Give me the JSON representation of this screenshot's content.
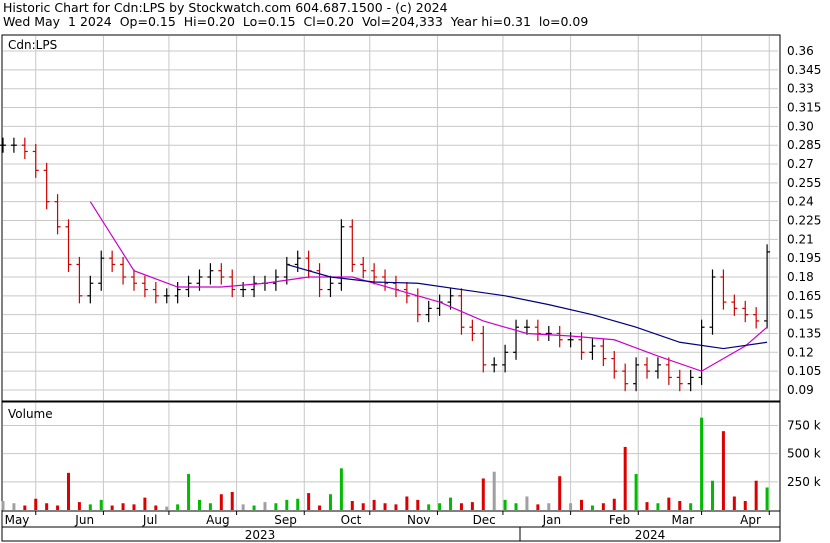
{
  "header": {
    "line1": "Historic Chart for Cdn:LPS by Stockwatch.com 604.687.1500 - (c) 2024",
    "line2": "Wed May  1 2024  Op=0.15  Hi=0.20  Lo=0.15  Cl=0.20  Vol=204,333  Year hi=0.31  lo=0.09"
  },
  "colors": {
    "up_bar": "#000000",
    "down_bar": "#cc0000",
    "ma_short": "#cc00cc",
    "ma_long": "#000080",
    "vol_up": "#00bb00",
    "vol_down": "#dd0000",
    "vol_flat": "#a0a0a0",
    "grid": "#c8c8c8"
  },
  "chart_data": [
    {
      "type": "ohlc",
      "title": "Cdn:LPS",
      "y_ticks": [
        "0.36",
        "0.345",
        "0.33",
        "0.315",
        "0.30",
        "0.285",
        "0.27",
        "0.255",
        "0.24",
        "0.225",
        "0.21",
        "0.195",
        "0.18",
        "0.165",
        "0.15",
        "0.135",
        "0.12",
        "0.105",
        "0.09"
      ],
      "ylim": [
        0.082,
        0.372
      ],
      "months": [
        "May",
        "Jun",
        "Jul",
        "Aug",
        "Sep",
        "Oct",
        "Nov",
        "Dec",
        "Jan",
        "Feb",
        "Mar",
        "Apr"
      ],
      "years": [
        "2023",
        "2024"
      ],
      "grid": true,
      "series": [
        {
          "style": "ohlc",
          "x": [
            0,
            5,
            10,
            15,
            20,
            25,
            30,
            35,
            40,
            45,
            50,
            55,
            60,
            65,
            70,
            75,
            80,
            85,
            90,
            95,
            100,
            105,
            110,
            115,
            120,
            125,
            130,
            135,
            140,
            145,
            150,
            155,
            160,
            165,
            170,
            175,
            180,
            185,
            190,
            195,
            200,
            205,
            210,
            215,
            220,
            225,
            230,
            235,
            240,
            245,
            250,
            255,
            260,
            265,
            270,
            275,
            280,
            285,
            290,
            295,
            300,
            305,
            310,
            315,
            320,
            325,
            330,
            335,
            340,
            345,
            350
          ],
          "close": [
            0.285,
            0.285,
            0.28,
            0.265,
            0.24,
            0.22,
            0.19,
            0.165,
            0.175,
            0.195,
            0.19,
            0.18,
            0.175,
            0.17,
            0.165,
            0.165,
            0.17,
            0.175,
            0.18,
            0.185,
            0.18,
            0.17,
            0.17,
            0.175,
            0.175,
            0.18,
            0.19,
            0.195,
            0.185,
            0.17,
            0.175,
            0.22,
            0.19,
            0.185,
            0.18,
            0.175,
            0.17,
            0.165,
            0.15,
            0.155,
            0.16,
            0.165,
            0.14,
            0.135,
            0.11,
            0.11,
            0.12,
            0.14,
            0.14,
            0.135,
            0.135,
            0.13,
            0.13,
            0.12,
            0.125,
            0.115,
            0.105,
            0.095,
            0.11,
            0.105,
            0.11,
            0.1,
            0.095,
            0.1,
            0.14,
            0.18,
            0.16,
            0.155,
            0.15,
            0.145,
            0.2
          ]
        },
        {
          "style": "line",
          "name": "",
          "x": [
            40,
            60,
            80,
            100,
            120,
            140,
            160,
            180,
            200,
            220,
            240,
            260,
            280,
            300,
            320,
            340,
            350
          ],
          "y": [
            0.24,
            0.185,
            0.172,
            0.172,
            0.175,
            0.18,
            0.18,
            0.17,
            0.16,
            0.145,
            0.135,
            0.133,
            0.13,
            0.117,
            0.105,
            0.125,
            0.14
          ]
        },
        {
          "style": "line",
          "name": "",
          "x": [
            130,
            150,
            170,
            190,
            210,
            230,
            250,
            270,
            290,
            310,
            330,
            350
          ],
          "y": [
            0.19,
            0.18,
            0.176,
            0.175,
            0.17,
            0.165,
            0.158,
            0.15,
            0.14,
            0.128,
            0.123,
            0.128
          ]
        }
      ]
    },
    {
      "type": "bar",
      "title": "Volume",
      "y_ticks": [
        "750 k",
        "500 k",
        "250 k"
      ],
      "ylim": [
        0,
        950
      ],
      "unit": "k",
      "series": [
        {
          "name": "",
          "x": [
            0,
            5,
            10,
            15,
            20,
            25,
            30,
            35,
            40,
            45,
            50,
            55,
            60,
            65,
            70,
            75,
            80,
            85,
            90,
            95,
            100,
            105,
            110,
            115,
            120,
            125,
            130,
            135,
            140,
            145,
            150,
            155,
            160,
            165,
            170,
            175,
            180,
            185,
            190,
            195,
            200,
            205,
            210,
            215,
            220,
            225,
            230,
            235,
            240,
            245,
            250,
            255,
            260,
            265,
            270,
            275,
            280,
            285,
            290,
            295,
            300,
            305,
            310,
            315,
            320,
            325,
            330,
            335,
            340,
            345,
            350
          ],
          "values": [
            80,
            60,
            40,
            100,
            60,
            40,
            330,
            70,
            50,
            90,
            40,
            60,
            50,
            110,
            40,
            30,
            50,
            320,
            90,
            60,
            140,
            160,
            50,
            40,
            70,
            60,
            90,
            100,
            150,
            40,
            140,
            370,
            80,
            60,
            90,
            60,
            50,
            120,
            90,
            50,
            60,
            110,
            60,
            70,
            280,
            340,
            90,
            60,
            120,
            50,
            60,
            300,
            60,
            90,
            40,
            60,
            100,
            560,
            320,
            70,
            60,
            110,
            80,
            60,
            820,
            260,
            700,
            120,
            80,
            260,
            200
          ]
        }
      ]
    }
  ]
}
